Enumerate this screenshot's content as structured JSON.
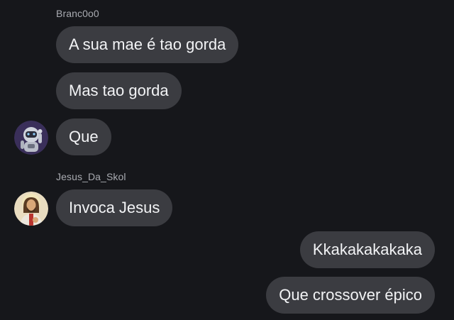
{
  "messages": {
    "group1": {
      "sender": "Branc0o0",
      "m1": "A sua mae é tao gorda",
      "m2": "Mas tao gorda",
      "m3": "Que",
      "avatar_icon": "astronaut-avatar-icon"
    },
    "group2": {
      "sender": "Jesus_Da_Skol",
      "m1": "Invoca Jesus",
      "avatar_icon": "jesus-avatar-icon"
    },
    "outgoing": {
      "m1": "Kkakakakakaka",
      "m2": "Que crossover épico"
    }
  },
  "colors": {
    "background": "#16171b",
    "bubble": "#3b3c41",
    "text": "#f2f3f5",
    "sender": "#a9abb1"
  }
}
